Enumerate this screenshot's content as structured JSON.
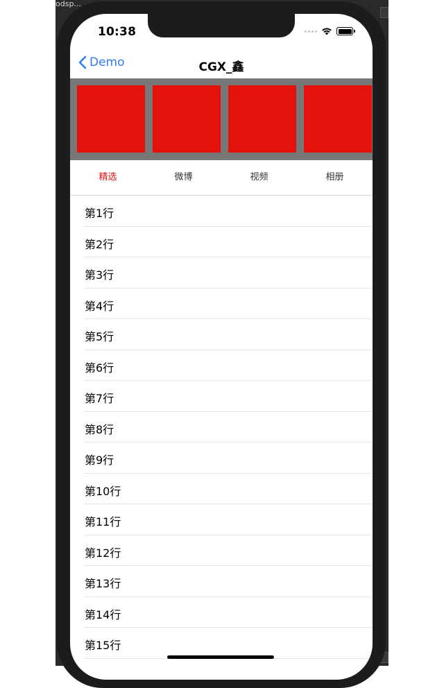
{
  "window": {
    "title_fragment": "odsp..."
  },
  "status_bar": {
    "time": "10:38"
  },
  "nav": {
    "back_label": "Demo",
    "title": "CGX_鑫"
  },
  "banner": {
    "tile_color": "#e3120b",
    "tile_count": 4
  },
  "tabs": [
    {
      "label": "精选",
      "active": true
    },
    {
      "label": "微博",
      "active": false
    },
    {
      "label": "视频",
      "active": false
    },
    {
      "label": "相册",
      "active": false
    }
  ],
  "rows": [
    {
      "label": "第1行"
    },
    {
      "label": "第2行"
    },
    {
      "label": "第3行"
    },
    {
      "label": "第4行"
    },
    {
      "label": "第5行"
    },
    {
      "label": "第6行"
    },
    {
      "label": "第7行"
    },
    {
      "label": "第8行"
    },
    {
      "label": "第9行"
    },
    {
      "label": "第10行"
    },
    {
      "label": "第11行"
    },
    {
      "label": "第12行"
    },
    {
      "label": "第13行"
    },
    {
      "label": "第14行"
    },
    {
      "label": "第15行"
    }
  ],
  "colors": {
    "accent": "#2f7cf6",
    "selected_tab": "#e3120b"
  }
}
